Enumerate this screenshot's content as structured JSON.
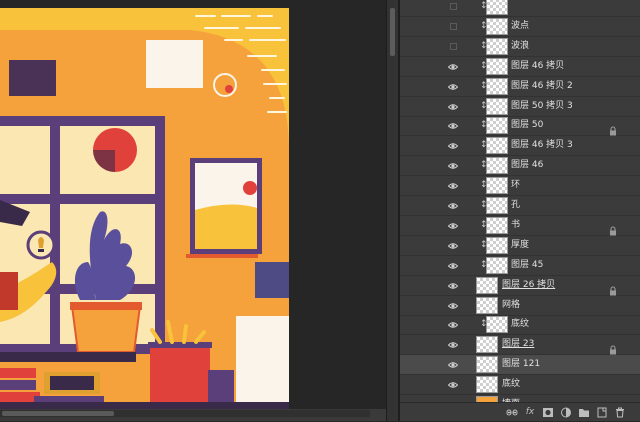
{
  "layers": [
    {
      "name": "",
      "visible": false,
      "clipped": true,
      "locked": false,
      "thumb": "checker"
    },
    {
      "name": "波点",
      "visible": false,
      "clipped": true,
      "locked": false,
      "thumb": "checker"
    },
    {
      "name": "波浪",
      "visible": false,
      "clipped": true,
      "locked": false,
      "thumb": "checker"
    },
    {
      "name": "图层 46 拷贝",
      "visible": true,
      "clipped": true,
      "locked": false,
      "thumb": "checker"
    },
    {
      "name": "图层 46 拷贝 2",
      "visible": true,
      "clipped": true,
      "locked": false,
      "thumb": "checker"
    },
    {
      "name": "图层 50 拷贝 3",
      "visible": true,
      "clipped": true,
      "locked": false,
      "thumb": "checker"
    },
    {
      "name": "图层 50",
      "visible": true,
      "clipped": true,
      "locked": true,
      "thumb": "checker"
    },
    {
      "name": "图层 46 拷贝 3",
      "visible": true,
      "clipped": true,
      "locked": false,
      "thumb": "checker"
    },
    {
      "name": "图层 46",
      "visible": true,
      "clipped": true,
      "locked": false,
      "thumb": "checker"
    },
    {
      "name": "环",
      "visible": true,
      "clipped": true,
      "locked": false,
      "thumb": "checker"
    },
    {
      "name": "孔",
      "visible": true,
      "clipped": true,
      "locked": false,
      "thumb": "checker"
    },
    {
      "name": "书",
      "visible": true,
      "clipped": true,
      "locked": true,
      "thumb": "checker"
    },
    {
      "name": "厚度",
      "visible": true,
      "clipped": true,
      "locked": false,
      "thumb": "checker"
    },
    {
      "name": "图层 45",
      "visible": true,
      "clipped": true,
      "locked": false,
      "thumb": "checker"
    },
    {
      "name": "图层 26 拷贝",
      "visible": true,
      "clipped": false,
      "locked": true,
      "thumb": "checker",
      "underline": true
    },
    {
      "name": "网格",
      "visible": true,
      "clipped": false,
      "locked": false,
      "thumb": "checker"
    },
    {
      "name": "底纹",
      "visible": true,
      "clipped": true,
      "locked": false,
      "thumb": "checker"
    },
    {
      "name": "图层 23",
      "visible": true,
      "clipped": false,
      "locked": true,
      "thumb": "checker",
      "underline": true
    },
    {
      "name": "图层 121",
      "visible": true,
      "clipped": false,
      "locked": false,
      "thumb": "checker",
      "selected": true
    },
    {
      "name": "底纹",
      "visible": true,
      "clipped": false,
      "locked": false,
      "thumb": "checker"
    },
    {
      "name": "墙面",
      "visible": true,
      "clipped": false,
      "locked": true,
      "thumb": "orange"
    }
  ],
  "panel_bottom_icons": [
    "link-icon",
    "fx-icon",
    "mask-icon",
    "adjustment-icon",
    "folder-icon",
    "new-layer-icon",
    "trash-icon"
  ],
  "panel_bottom_fx": "fx",
  "colors": {
    "canvas_orange": "#f6a23c",
    "canvas_yellow": "#f8c23a",
    "window_frame": "#5a3f7a",
    "window_pane": "#fbe7b2",
    "red_accent": "#e0413a",
    "plant_purple": "#5a4f9a",
    "panel_bg": "#3b3b3b"
  }
}
